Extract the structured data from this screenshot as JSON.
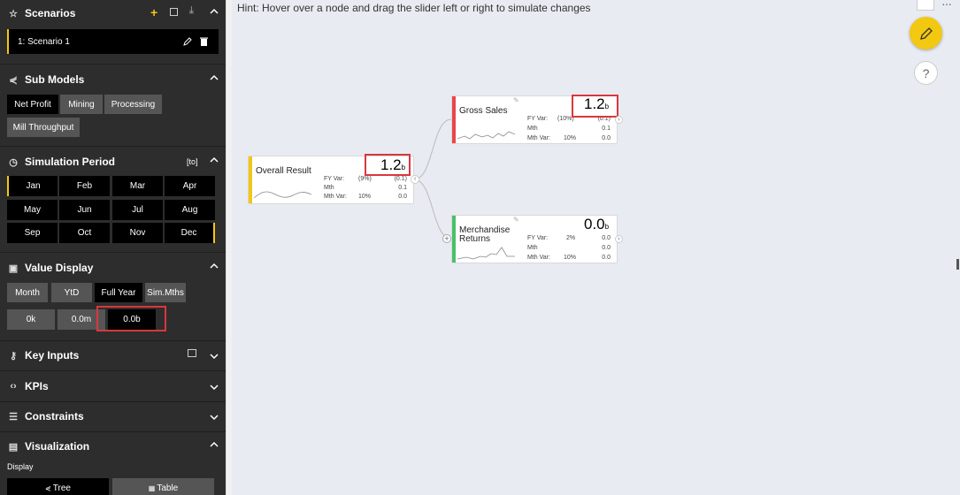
{
  "hint": "Hint: Hover over a node and drag the slider left or right to simulate changes",
  "scenarios": {
    "title": "Scenarios",
    "selected": "1: Scenario 1"
  },
  "sub_models": {
    "title": "Sub Models",
    "items": [
      "Net Profit",
      "Mining",
      "Processing",
      "Mill Throughput"
    ]
  },
  "simulation_period": {
    "title": "Simulation Period",
    "badge": "[to]",
    "months": [
      "Jan",
      "Feb",
      "Mar",
      "Apr",
      "May",
      "Jun",
      "Jul",
      "Aug",
      "Sep",
      "Oct",
      "Nov",
      "Dec"
    ]
  },
  "value_display": {
    "title": "Value Display",
    "modes": [
      "Month",
      "YtD",
      "Full Year",
      "Sim.Mths"
    ],
    "selected_mode": "Full Year",
    "units": [
      "0k",
      "0.0m",
      "0.0b"
    ],
    "selected_unit": "0.0b"
  },
  "key_inputs": {
    "title": "Key Inputs"
  },
  "kpis": {
    "title": "KPIs"
  },
  "constraints": {
    "title": "Constraints"
  },
  "visualization": {
    "title": "Visualization",
    "display_label": "Display",
    "tree_label": "Tree",
    "table_label": "Table"
  },
  "nodes": {
    "overall": {
      "title": "Overall Result",
      "value": "1.2",
      "unit": "b",
      "fy_var_label": "FY Var:",
      "fy_var_pct": "(9%)",
      "fy_var_val": "(0.1)",
      "mth_label": "Mth",
      "mth_val": "0.1",
      "mth_var_label": "Mth Var:",
      "mth_var_pct": "10%",
      "mth_var_val": "0.0",
      "color": "#f2c811"
    },
    "gross_sales": {
      "title": "Gross Sales",
      "value": "1.2",
      "unit": "b",
      "fy_var_label": "FY Var:",
      "fy_var_pct": "(10%)",
      "fy_var_val": "(0.1)",
      "mth_label": "Mth",
      "mth_val": "0.1",
      "mth_var_label": "Mth Var:",
      "mth_var_pct": "10%",
      "mth_var_val": "0.0",
      "color": "#e8474c"
    },
    "merch_returns": {
      "title_line1": "Merchandise",
      "title_line2": "Returns",
      "value": "0.0",
      "unit": "b",
      "fy_var_label": "FY Var:",
      "fy_var_pct": "2%",
      "fy_var_val": "0.0",
      "mth_label": "Mth",
      "mth_val": "0.0",
      "mth_var_label": "Mth Var:",
      "mth_var_pct": "10%",
      "mth_var_val": "0.0",
      "color": "#4bbf6b"
    }
  }
}
